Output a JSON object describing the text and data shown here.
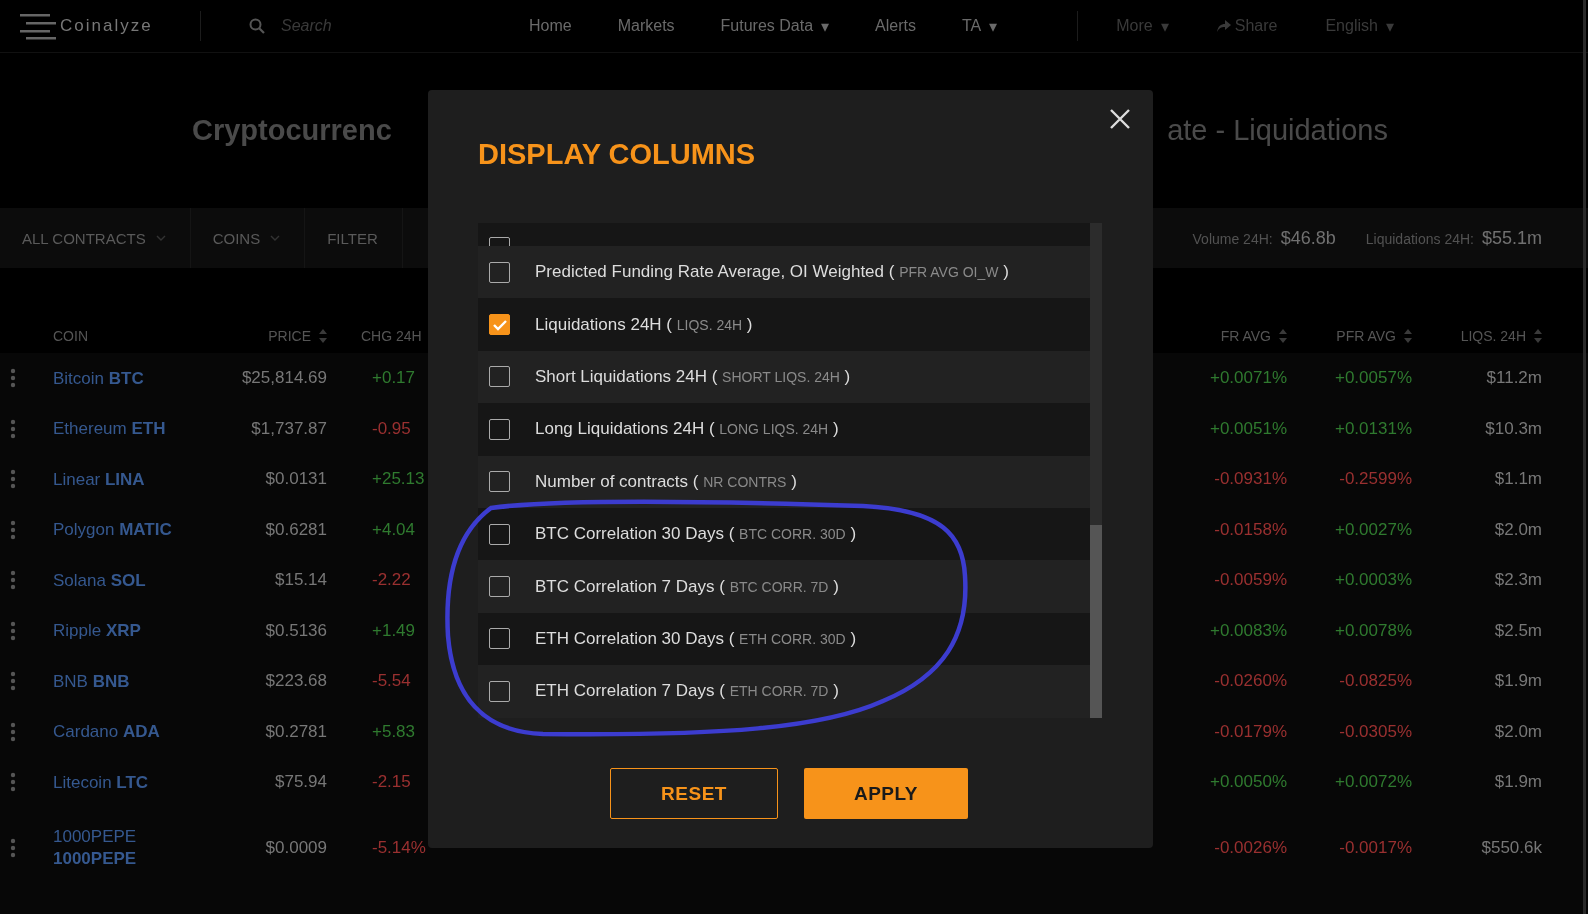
{
  "navbar": {
    "logo": "Coinalyze",
    "search": {
      "placeholder": "Search"
    },
    "links": [
      {
        "label": "Home"
      },
      {
        "label": "Markets"
      },
      {
        "label": "Futures Data",
        "caret": "▾"
      },
      {
        "label": "Alerts"
      },
      {
        "label": "TA",
        "caret": "▾"
      }
    ],
    "secondary": [
      {
        "label": "More",
        "kind": "dropdown",
        "caret": "▾"
      },
      {
        "label": "Share",
        "kind": "share"
      },
      {
        "label": "English",
        "kind": "dropdown",
        "caret": "▾"
      }
    ]
  },
  "page_title": {
    "left": "Cryptocurrenc",
    "right": "ate - Liquidations"
  },
  "filter_bar": {
    "items": [
      {
        "label": "ALL CONTRACTS",
        "kind": "dropdown"
      },
      {
        "label": "COINS",
        "kind": "dropdown"
      },
      {
        "label": "FILTER",
        "kind": "button"
      }
    ],
    "stats": [
      {
        "label": "Volume 24H:",
        "value": "$46.8b"
      },
      {
        "label": "Liquidations 24H:",
        "value": "$55.1m"
      }
    ]
  },
  "table": {
    "columns_left": [
      {
        "label": "COIN",
        "sortable": false
      },
      {
        "label": "PRICE",
        "sortable": true
      },
      {
        "label": "CHG 24H"
      }
    ],
    "columns_right": [
      {
        "label": "FR AVG",
        "sortable": true
      },
      {
        "label": "PFR AVG",
        "sortable": true
      },
      {
        "label": "LIQS. 24H",
        "sortable": true
      }
    ],
    "rows": [
      {
        "coin": "Bitcoin **BTC**",
        "price": "$25,814.69",
        "chg_24h": {
          "text": "+0.17",
          "positive": true
        },
        "fr_avg": {
          "text": "+0.0071%",
          "positive": true
        },
        "pfr_avg": {
          "text": "+0.0057%",
          "positive": true
        },
        "liqs_24h": "$11.2m"
      },
      {
        "coin": "Ethereum **ETH**",
        "price": "$1,737.87",
        "chg_24h": {
          "text": "-0.95",
          "positive": false
        },
        "fr_avg": {
          "text": "+0.0051%",
          "positive": true
        },
        "pfr_avg": {
          "text": "+0.0131%",
          "positive": true
        },
        "liqs_24h": "$10.3m"
      },
      {
        "coin": "Linear **LINA**",
        "price": "$0.0131",
        "chg_24h": {
          "text": "+25.13",
          "positive": true
        },
        "fr_avg": {
          "text": "-0.0931%",
          "positive": false
        },
        "pfr_avg": {
          "text": "-0.2599%",
          "positive": false
        },
        "liqs_24h": "$1.1m"
      },
      {
        "coin": "Polygon **MATIC**",
        "price": "$0.6281",
        "chg_24h": {
          "text": "+4.04",
          "positive": true
        },
        "fr_avg": {
          "text": "-0.0158%",
          "positive": false
        },
        "pfr_avg": {
          "text": "+0.0027%",
          "positive": true
        },
        "liqs_24h": "$2.0m"
      },
      {
        "coin": "Solana **SOL**",
        "price": "$15.14",
        "chg_24h": {
          "text": "-2.22",
          "positive": false
        },
        "fr_avg": {
          "text": "-0.0059%",
          "positive": false
        },
        "pfr_avg": {
          "text": "+0.0003%",
          "positive": true
        },
        "liqs_24h": "$2.3m"
      },
      {
        "coin": "Ripple **XRP**",
        "price": "$0.5136",
        "chg_24h": {
          "text": "+1.49",
          "positive": true
        },
        "fr_avg": {
          "text": "+0.0083%",
          "positive": true
        },
        "pfr_avg": {
          "text": "+0.0078%",
          "positive": true
        },
        "liqs_24h": "$2.5m"
      },
      {
        "coin": "BNB **BNB**",
        "price": "$223.68",
        "chg_24h": {
          "text": "-5.54",
          "positive": false
        },
        "fr_avg": {
          "text": "-0.0260%",
          "positive": false
        },
        "pfr_avg": {
          "text": "-0.0825%",
          "positive": false
        },
        "liqs_24h": "$1.9m"
      },
      {
        "coin": "Cardano **ADA**",
        "price": "$0.2781",
        "chg_24h": {
          "text": "+5.83",
          "positive": true
        },
        "fr_avg": {
          "text": "-0.0179%",
          "positive": false
        },
        "pfr_avg": {
          "text": "-0.0305%",
          "positive": false
        },
        "liqs_24h": "$2.0m"
      },
      {
        "coin": "Litecoin **LTC**",
        "price": "$75.94",
        "chg_24h": {
          "text": "-2.15",
          "positive": false
        },
        "fr_avg": {
          "text": "+0.0050%",
          "positive": true
        },
        "pfr_avg": {
          "text": "+0.0072%",
          "positive": true
        },
        "liqs_24h": "$1.9m"
      },
      {
        "coin": "1000PEPE **1000PEPE**",
        "price": "$0.0009",
        "chg_24h": {
          "text": "-5.14%",
          "positive": false
        },
        "fr_avg": {
          "text": "-0.0026%",
          "positive": false
        },
        "pfr_avg": {
          "text": "-0.0017%",
          "positive": false
        },
        "liqs_24h": "$550.6k"
      }
    ]
  },
  "modal": {
    "title": "DISPLAY COLUMNS",
    "clipped_option": {
      "checked": false
    },
    "options": [
      {
        "label": "Predicted Funding Rate Average, OI Weighted (",
        "code": "PFR AVG OI_W",
        "close": ")",
        "checked": false
      },
      {
        "label": "Liquidations 24H (",
        "code": "LIQS. 24H",
        "close": ")",
        "checked": true
      },
      {
        "label": "Short Liquidations 24H (",
        "code": "SHORT LIQS. 24H",
        "close": ")",
        "checked": false
      },
      {
        "label": "Long Liquidations 24H (",
        "code": "LONG LIQS. 24H",
        "close": ")",
        "checked": false
      },
      {
        "label": "Number of contracts (",
        "code": "NR CONTRS",
        "close": ")",
        "checked": false
      },
      {
        "label": "BTC Correlation 30 Days (",
        "code": "BTC CORR. 30D",
        "close": ")",
        "checked": false
      },
      {
        "label": "BTC Correlation 7 Days (",
        "code": "BTC CORR. 7D",
        "close": ")",
        "checked": false
      },
      {
        "label": "ETH Correlation 30 Days (",
        "code": "ETH CORR. 30D",
        "close": ")",
        "checked": false
      },
      {
        "label": "ETH Correlation 7 Days (",
        "code": "ETH CORR. 7D",
        "close": ")",
        "checked": false
      }
    ],
    "buttons": [
      {
        "label": "RESET",
        "kind": "secondary"
      },
      {
        "label": "APPLY",
        "kind": "primary"
      }
    ]
  }
}
